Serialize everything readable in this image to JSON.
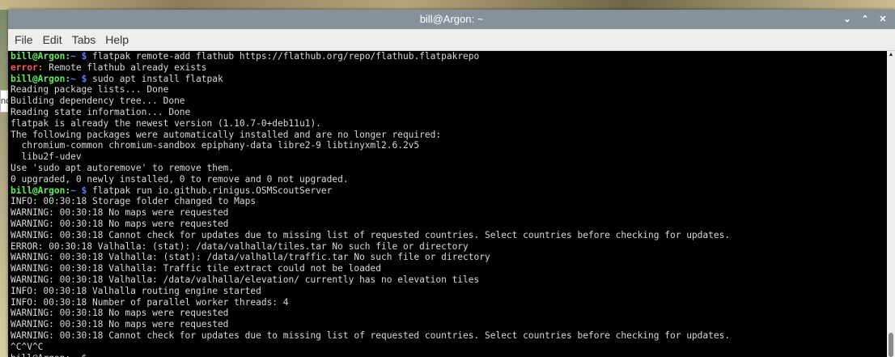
{
  "window": {
    "title": "bill@Argon: ~",
    "controls": [
      "⌄",
      "⌃",
      "✕"
    ]
  },
  "menu": [
    "File",
    "Edit",
    "Tabs",
    "Help"
  ],
  "side_tab_text": "no",
  "terminal": {
    "lines": [
      {
        "user": "bill@Argon:",
        "path": "~ $",
        "text": " flatpak remote-add flathub https://flathub.org/repo/flathub.flatpakrepo"
      },
      {
        "error": "error:",
        "text": " Remote flathub already exists"
      },
      {
        "user": "bill@Argon:",
        "path": "~ $",
        "text": " sudo apt install flatpak"
      },
      {
        "text": "Reading package lists... Done"
      },
      {
        "text": "Building dependency tree... Done"
      },
      {
        "text": "Reading state information... Done"
      },
      {
        "text": "flatpak is already the newest version (1.10.7-0+deb11u1)."
      },
      {
        "text": "The following packages were automatically installed and are no longer required:"
      },
      {
        "text": "  chromium-common chromium-sandbox epiphany-data libre2-9 libtinyxml2.6.2v5"
      },
      {
        "text": "  libu2f-udev"
      },
      {
        "text": "Use 'sudo apt autoremove' to remove them."
      },
      {
        "text": "0 upgraded, 0 newly installed, 0 to remove and 0 not upgraded."
      },
      {
        "user": "bill@Argon:",
        "path": "~ $",
        "text": " flatpak run io.github.rinigus.OSMScoutServer"
      },
      {
        "text": "INFO: 00:30:18 Storage folder changed to Maps"
      },
      {
        "text": "WARNING: 00:30:18 No maps were requested"
      },
      {
        "text": "WARNING: 00:30:18 No maps were requested"
      },
      {
        "text": "WARNING: 00:30:18 Cannot check for updates due to missing list of requested countries. Select countries before checking for updates."
      },
      {
        "text": "ERROR: 00:30:18 Valhalla: (stat): /data/valhalla/tiles.tar No such file or directory"
      },
      {
        "text": "WARNING: 00:30:18 Valhalla: (stat): /data/valhalla/traffic.tar No such file or directory"
      },
      {
        "text": "WARNING: 00:30:18 Valhalla: Traffic tile extract could not be loaded"
      },
      {
        "text": "WARNING: 00:30:18 Valhalla: /data/valhalla/elevation/ currently has no elevation tiles"
      },
      {
        "text": "INFO: 00:30:18 Valhalla routing engine started"
      },
      {
        "text": "INFO: 00:30:18 Number of parallel worker threads: 4"
      },
      {
        "text": "WARNING: 00:30:18 No maps were requested"
      },
      {
        "text": "WARNING: 00:30:18 No maps were requested"
      },
      {
        "text": "WARNING: 00:30:18 Cannot check for updates due to missing list of requested countries. Select countries before checking for updates."
      },
      {
        "text": "^C^V^C"
      },
      {
        "text": "bill@Argon:~ $"
      }
    ]
  },
  "colors": {
    "prompt_user": "#5cf25c",
    "prompt_path": "#5c7cff",
    "error": "#ff5555",
    "titlebar": "#87919b"
  }
}
